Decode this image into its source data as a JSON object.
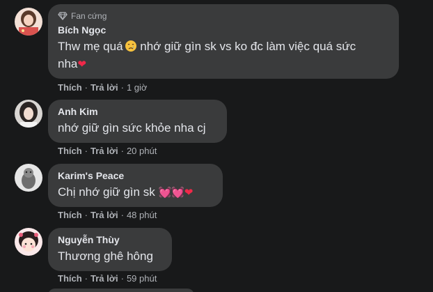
{
  "comments": [
    {
      "badge": "Fan cứng",
      "author": "Bích Ngọc",
      "text_line1": "Thw mẹ quá",
      "text_line1_rest": " nhớ giữ gìn sk vs ko đc làm việc quá sức",
      "text_line2": "nha",
      "emoji_end": "❤",
      "like": "Thích",
      "reply": "Trả lời",
      "time": "1 giờ"
    },
    {
      "author": "Anh Kim",
      "text": "nhớ giữ gìn sức khỏe nha cj",
      "like": "Thích",
      "reply": "Trả lời",
      "time": "20 phút"
    },
    {
      "author": "Karim's Peace",
      "text": "Chị nhớ giữ gìn sk ",
      "emojis": "💓💓❤",
      "like": "Thích",
      "reply": "Trả lời",
      "time": "48 phút"
    },
    {
      "author": "Nguyễn Thùy",
      "text": "Thương ghê hông",
      "like": "Thích",
      "reply": "Trả lời",
      "time": "59 phút"
    }
  ],
  "separator": "·",
  "colors": {
    "background": "#18191a",
    "bubble": "#3a3b3c",
    "text": "#e4e6eb",
    "secondary": "#b0b3b8",
    "heart": "#f02849"
  },
  "icons": {
    "badge": "diamond-icon",
    "crying_face": "crying-face-emoji",
    "heart": "heart-emoji"
  }
}
